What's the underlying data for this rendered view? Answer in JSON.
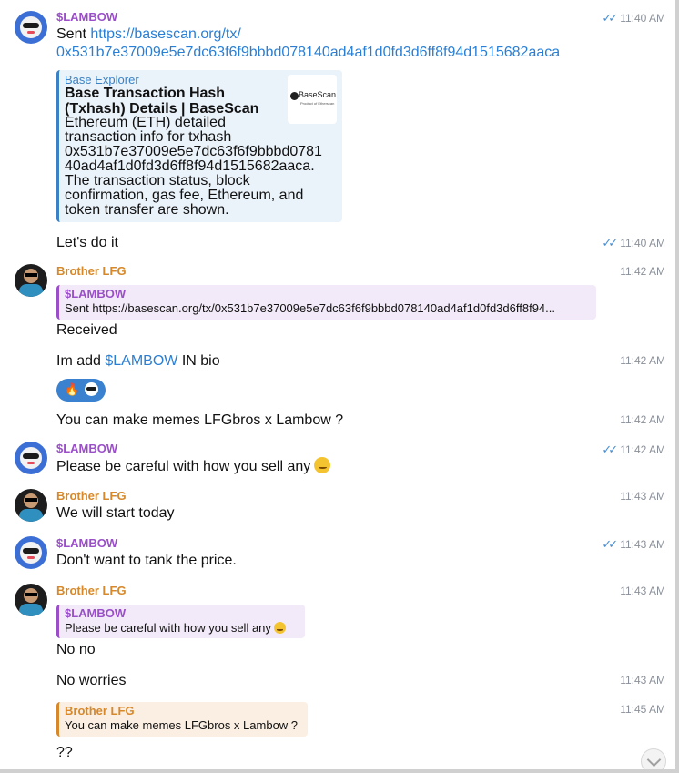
{
  "messages": [
    {
      "sender": "$LAMBOW",
      "time": "11:40 AM",
      "check": "✓✓",
      "text_prefix": "Sent ",
      "link_line1": "https://basescan.org/tx/",
      "link_line2": "0x531b7e37009e5e7dc63f6f9bbbd078140ad4af1d0fd3d6ff8f94d1515682aaca",
      "preview": {
        "site": "Base Explorer",
        "title": "Base Transaction Hash (Txhash) Details | BaseScan",
        "description": "Ethereum (ETH) detailed\ntransaction info for txhash\n0x531b7e37009e5e7dc63f6f9bbbd0781\n40ad4af1d0fd3d6ff8f94d1515682aaca.\nThe transaction status, block\nconfirmation, gas fee, Ethereum, and\ntoken transfer are shown.",
        "thumb_name": "BaseScan",
        "thumb_sub": "Product of Etherscan"
      }
    },
    {
      "text": "Let's do it",
      "time": "11:40 AM",
      "check": "✓✓"
    },
    {
      "sender": "Brother LFG",
      "time": "11:42 AM",
      "reply": {
        "name": "$LAMBOW",
        "text": "Sent https://basescan.org/tx/0x531b7e37009e5e7dc63f6f9bbbd078140ad4af1d0fd3d6ff8f94..."
      },
      "text": "Received"
    },
    {
      "text_prefix": "Im add ",
      "mention": "$LAMBOW",
      "text_suffix": " IN bio",
      "time": "11:42 AM"
    },
    {
      "text": "You can make memes LFGbros x Lambow ?",
      "time": "11:42 AM"
    },
    {
      "sender": "$LAMBOW",
      "time": "11:42 AM",
      "check": "✓✓",
      "text": "Please be careful with how you sell any"
    },
    {
      "sender": "Brother LFG",
      "time": "11:43 AM",
      "text": "We will start today"
    },
    {
      "sender": "$LAMBOW",
      "time": "11:43 AM",
      "check": "✓✓",
      "text": "Don't want to tank the price."
    },
    {
      "sender": "Brother LFG",
      "time": "11:43 AM",
      "reply": {
        "name": "$LAMBOW",
        "text": "Please be careful with how you sell any"
      },
      "text": "No no"
    },
    {
      "text": "No worries",
      "time": "11:43 AM"
    },
    {
      "time": "11:45 AM",
      "reply": {
        "name": "Brother LFG",
        "text": "You can make memes LFGbros x Lambow ?"
      },
      "text": "??"
    }
  ],
  "icons": {
    "reaction_1": "fire-icon",
    "reaction_2": "cool-face-icon",
    "smiley": "slightly-smiling-face-icon",
    "scroll_down": "chevron-down-icon"
  },
  "colors": {
    "lambow_name": "#9a4fc9",
    "brother_name": "#d6882a",
    "link": "#2a7fd4",
    "read_check": "#4a8fd0",
    "reaction_bg": "#3a82cf"
  }
}
